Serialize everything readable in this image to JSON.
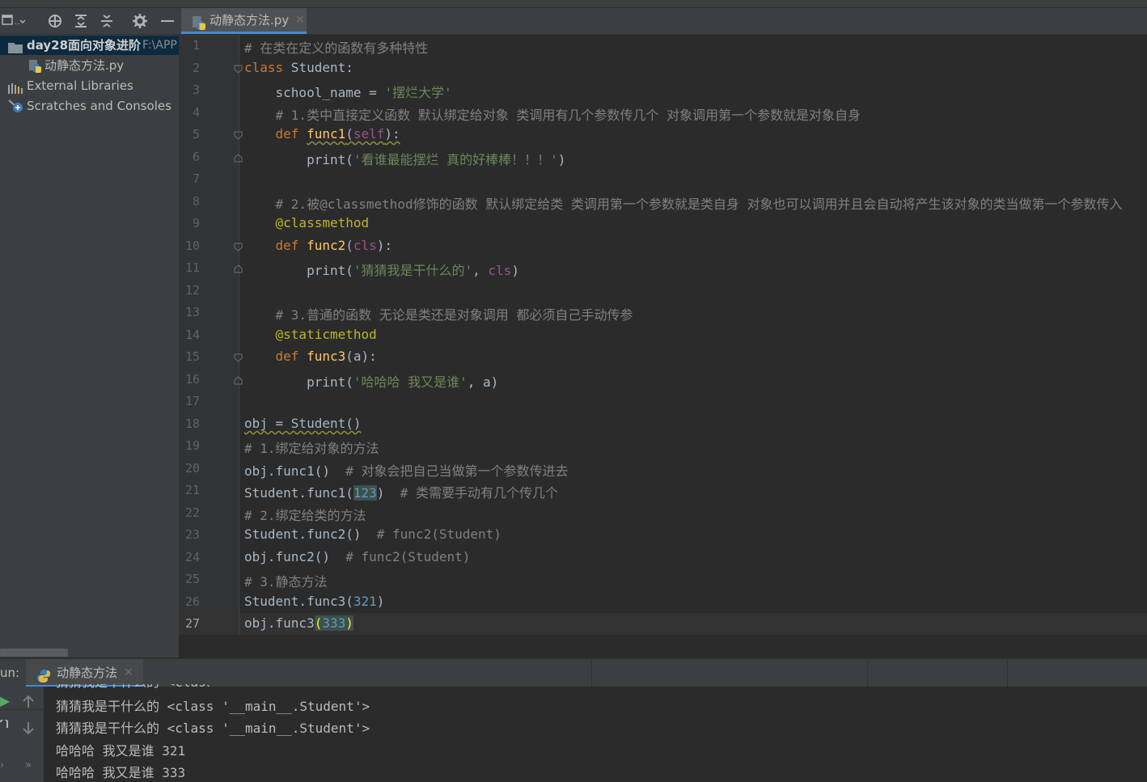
{
  "project_panel": {
    "toolbar_icons": [
      "layout-icon",
      "target-icon",
      "expand-all-icon",
      "collapse-all-icon",
      "gear-icon",
      "minimize-icon"
    ],
    "root_folder": "day28面向对象进阶",
    "root_path": "F:\\APP",
    "file": "动静态方法.py",
    "external_libraries": "External Libraries",
    "scratches": "Scratches and Consoles"
  },
  "editor": {
    "active_tab": "动静态方法.py",
    "line_numbers": [
      "1",
      "2",
      "3",
      "4",
      "5",
      "6",
      "7",
      "8",
      "9",
      "10",
      "11",
      "12",
      "13",
      "14",
      "15",
      "16",
      "17",
      "18",
      "19",
      "20",
      "21",
      "22",
      "23",
      "24",
      "25",
      "26",
      "27"
    ],
    "lines": [
      "# 在类在定义的函数有多种特性",
      "class Student:",
      "    school_name = '摆烂大学'",
      "    # 1.类中直接定义函数 默认绑定给对象 类调用有几个参数传几个 对象调用第一个参数就是对象自身",
      "    def func1(self):",
      "        print('看谁最能摆烂 真的好棒棒！！！')",
      "",
      "    # 2.被@classmethod修饰的函数 默认绑定给类 类调用第一个参数就是类自身 对象也可以调用并且会自动将产生该对象的类当做第一个参数传入",
      "    @classmethod",
      "    def func2(cls):",
      "        print('猜猜我是干什么的', cls)",
      "",
      "    # 3.普通的函数 无论是类还是对象调用 都必须自己手动传参",
      "    @staticmethod",
      "    def func3(a):",
      "        print('哈哈哈 我又是谁', a)",
      "",
      "obj = Student()",
      "# 1.绑定给对象的方法",
      "obj.func1()  # 对象会把自己当做第一个参数传进去",
      "Student.func1(123)  # 类需要手动有几个传几个",
      "# 2.绑定给类的方法",
      "Student.func2()  # func2(Student)",
      "obj.func2()  # func2(Student)",
      "# 3.静态方法",
      "Student.func3(321)",
      "obj.func3(333)"
    ]
  },
  "run_panel": {
    "label": "un:",
    "tab": "动静态方法",
    "output": [
      "猜猜我是干什么的 <class '__main__.Student'>",
      "猜猜我是干什么的 <class '__main__.Student'>",
      "哈哈哈 我又是谁 321",
      "哈哈哈 我又是谁 333"
    ]
  },
  "colors": {
    "keyword": "#cc7832",
    "function": "#ffc66d",
    "string": "#6a8759",
    "comment": "#808080",
    "number": "#6897bb",
    "self": "#94558d",
    "decorator": "#bbb529",
    "accent": "#4a88c7"
  }
}
